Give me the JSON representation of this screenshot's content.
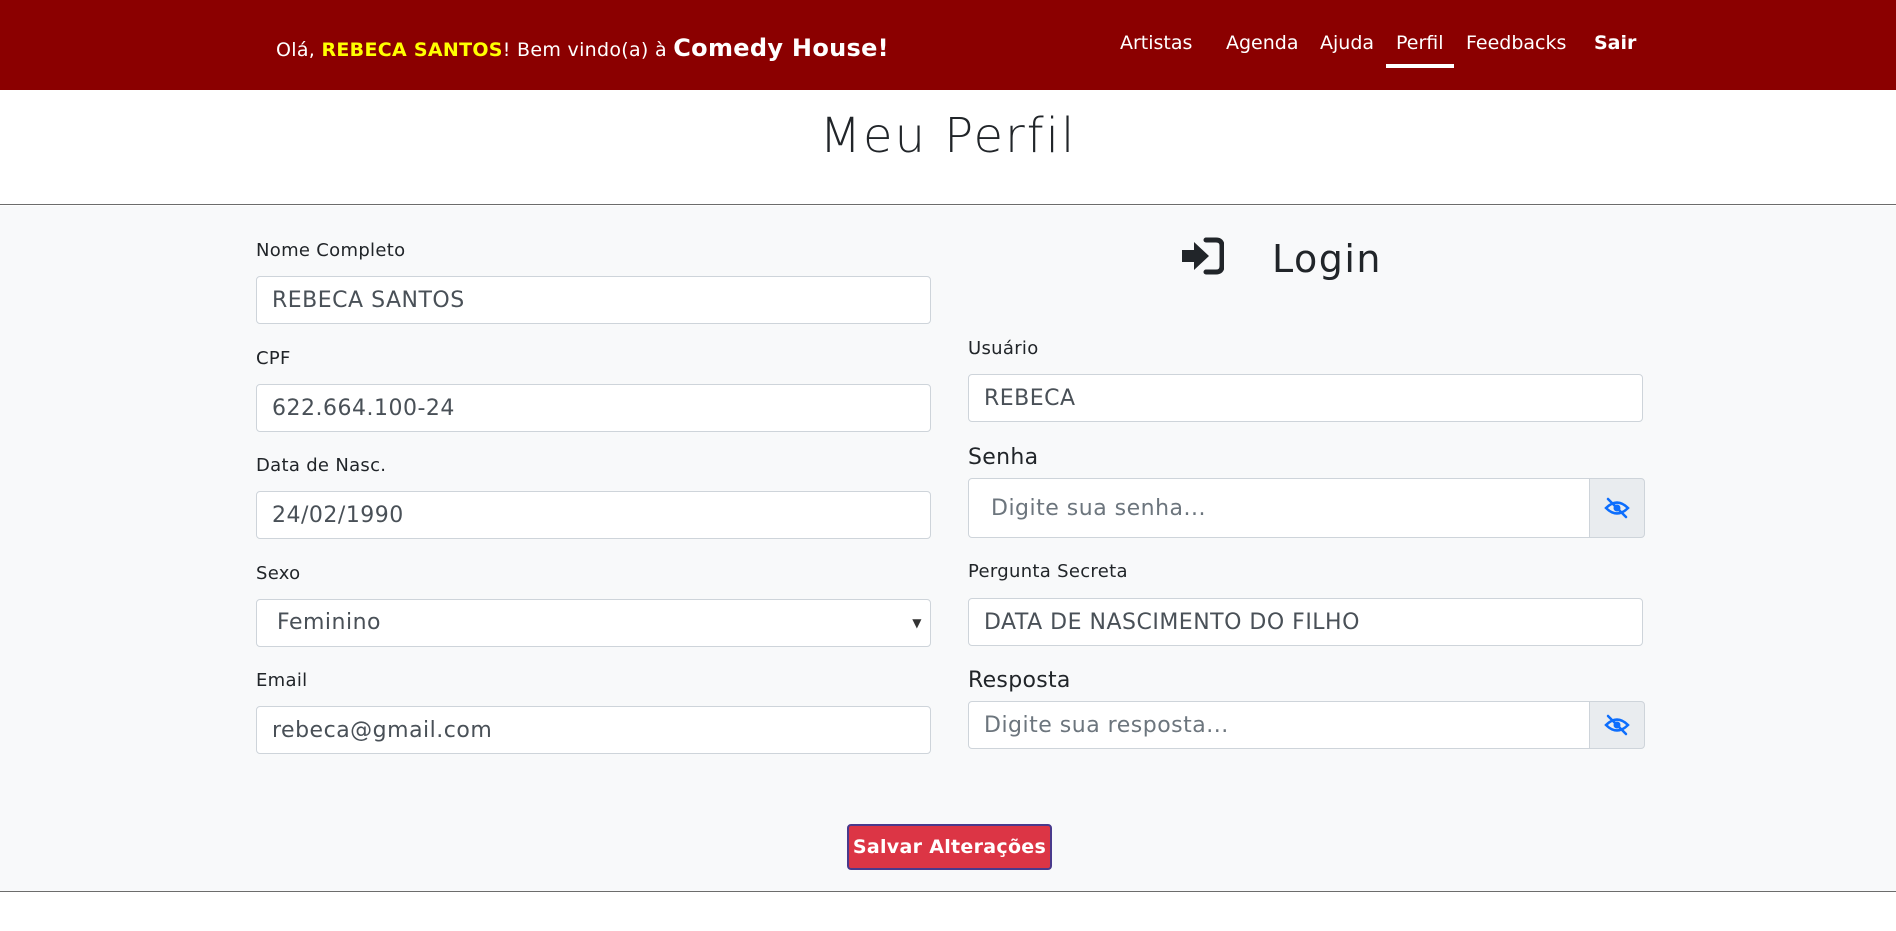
{
  "nav": {
    "greeting_prefix": "Olá, ",
    "user_name": "REBECA SANTOS",
    "greeting_mid": "! Bem vindo(a) à ",
    "brand": "Comedy House!",
    "links": [
      "Artistas",
      "Agenda",
      "Ajuda",
      "Perfil",
      "Feedbacks",
      "Sair"
    ],
    "active": "Perfil"
  },
  "page": {
    "title": "Meu Perfil"
  },
  "personal": {
    "nome_label": "Nome Completo",
    "nome_value": "REBECA SANTOS",
    "cpf_label": "CPF",
    "cpf_value": "622.664.100-24",
    "nasc_label": "Data de Nasc.",
    "nasc_value": "24/02/1990",
    "sexo_label": "Sexo",
    "sexo_value": "Feminino",
    "email_label": "Email",
    "email_value": "rebeca@gmail.com"
  },
  "login": {
    "title": "Login",
    "usuario_label": "Usuário",
    "usuario_value": "REBECA",
    "senha_label": "Senha",
    "senha_placeholder": "Digite sua senha...",
    "pergunta_label": "Pergunta Secreta",
    "pergunta_value": "DATA DE NASCIMENTO DO FILHO",
    "resposta_label": "Resposta",
    "resposta_placeholder": "Digite sua resposta..."
  },
  "actions": {
    "save_label": "Salvar Alterações"
  },
  "icons": {
    "login": "sign-in-icon",
    "eye": "eye-slash-icon"
  },
  "colors": {
    "navbar": "#8b0000",
    "username": "#ffff00",
    "button": "#dc3545",
    "eye": "#0d6efd"
  }
}
